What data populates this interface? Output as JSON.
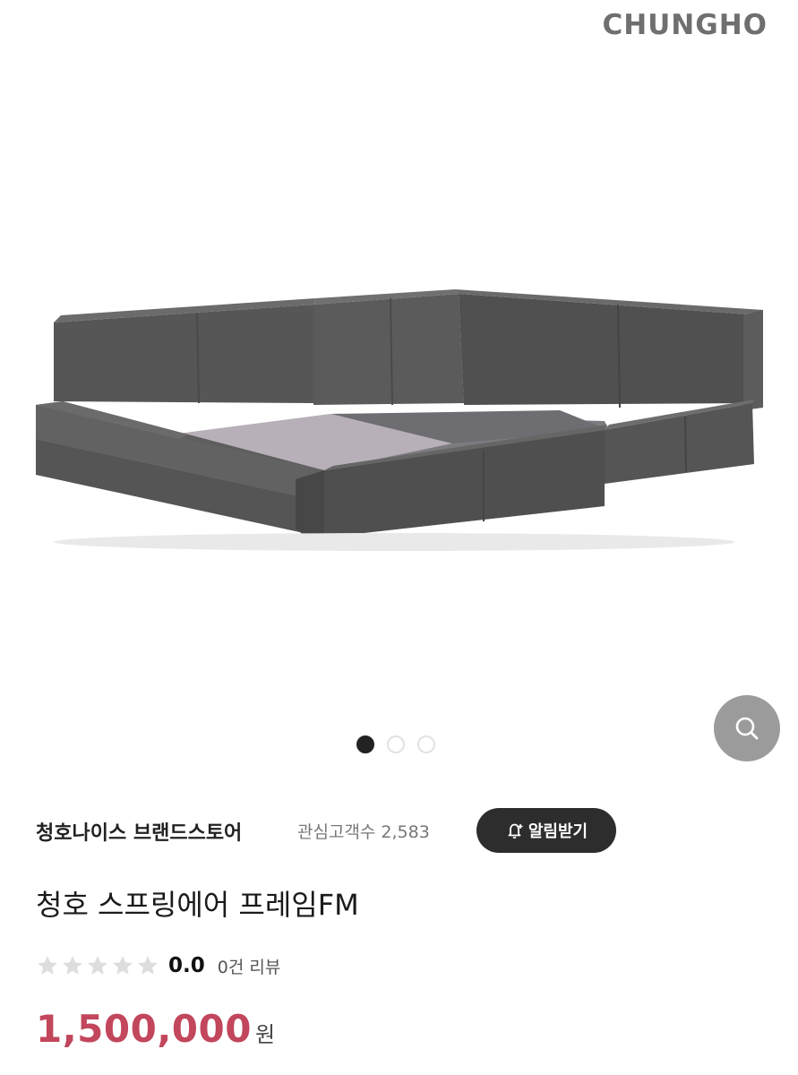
{
  "gallery": {
    "watermark": "CHUNGHO",
    "product_image": "grey leather floor bed frame",
    "slide_count": 3,
    "active_slide": 1,
    "zoom_icon": "search-icon"
  },
  "store": {
    "name": "청호나이스 브랜드스토어",
    "followers_label": "관심고객수",
    "followers_count": "2,583",
    "alert_button_label": "알림받기",
    "alert_icon": "bell-plus-icon"
  },
  "product": {
    "title": "청호 스프링에어 프레임FM",
    "rating": {
      "stars_filled": 0,
      "stars_total": 5,
      "value": "0.0",
      "review_count": "0건 리뷰"
    },
    "price": "1,500,000",
    "currency": "원"
  },
  "colors": {
    "price": "#c2465c",
    "alert_button_bg": "#2d2d2d",
    "star_empty": "#dddddd",
    "zoom_button_bg": "#8a8a8a"
  }
}
